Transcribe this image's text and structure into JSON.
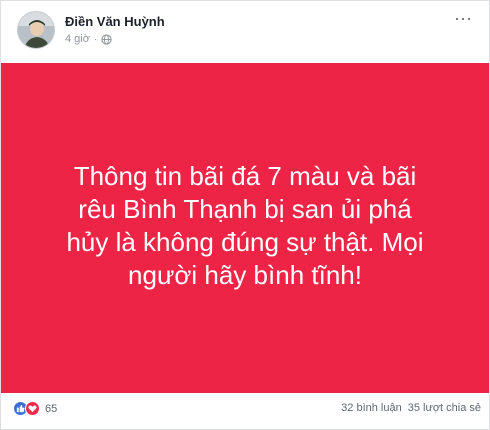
{
  "post": {
    "author": "Điền Văn Huỳnh",
    "time": "4 giờ",
    "privacy_icon": "globe-icon",
    "banner_text": "Thông tin bãi đá 7 màu và bãi rêu Bình Thạnh bị san ủi phá hủy là không đúng sự thật. Mọi người hãy bình tĩnh!",
    "banner_color": "#ee2447"
  },
  "footer": {
    "reaction_count": "65",
    "comments": "32 bình luận",
    "shares": "35 lượt chia sẻ"
  }
}
